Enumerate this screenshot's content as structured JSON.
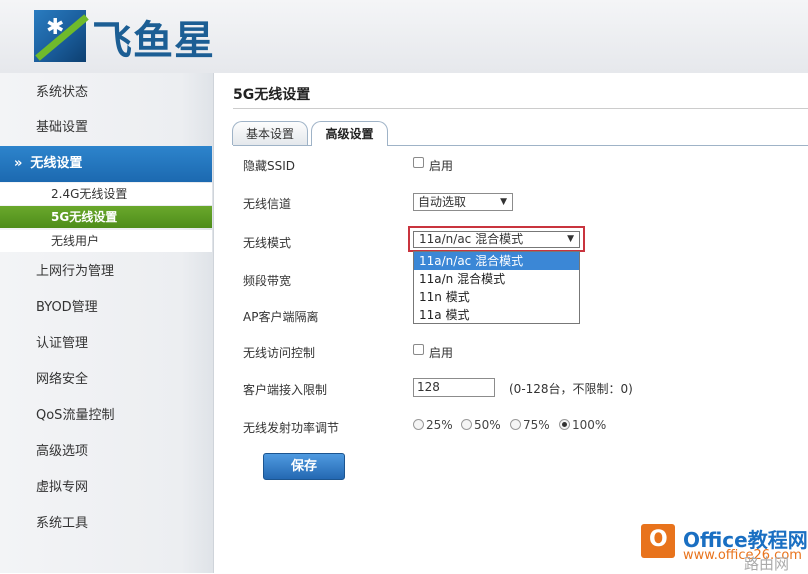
{
  "logo": {
    "text": "飞鱼星"
  },
  "sidebar": {
    "items": [
      {
        "label": "系统状态"
      },
      {
        "label": "基础设置"
      },
      {
        "label": "无线设置",
        "chevron": "»",
        "active": true
      },
      {
        "label": "上网行为管理"
      },
      {
        "label": "BYOD管理"
      },
      {
        "label": "认证管理"
      },
      {
        "label": "网络安全"
      },
      {
        "label": "QoS流量控制"
      },
      {
        "label": "高级选项"
      },
      {
        "label": "虚拟专网"
      },
      {
        "label": "系统工具"
      }
    ],
    "subitems": [
      {
        "label": "2.4G无线设置"
      },
      {
        "label": "5G无线设置",
        "active": true
      },
      {
        "label": "无线用户"
      }
    ]
  },
  "main": {
    "title": "5G无线设置",
    "tabs": [
      {
        "label": "基本设置"
      },
      {
        "label": "高级设置",
        "active": true
      }
    ],
    "fields": {
      "hide_ssid": {
        "label": "隐藏SSID",
        "checkbox_label": "启用",
        "checked": false
      },
      "channel": {
        "label": "无线信道",
        "value": "自动选取"
      },
      "mode": {
        "label": "无线模式",
        "value": "11a/n/ac 混合模式",
        "options": [
          "11a/n/ac 混合模式",
          "11a/n 混合模式",
          "11n 模式",
          "11a 模式"
        ]
      },
      "bandwidth": {
        "label": "频段带宽"
      },
      "ap_isolation": {
        "label": "AP客户端隔离"
      },
      "access_control": {
        "label": "无线访问控制",
        "checkbox_label": "启用",
        "checked": false
      },
      "client_limit": {
        "label": "客户端接入限制",
        "value": "128",
        "hint": "(0-128台，不限制：0)"
      },
      "tx_power": {
        "label": "无线发射功率调节",
        "options": [
          "25%",
          "50%",
          "75%",
          "100%"
        ],
        "selected": "100%"
      }
    },
    "save_label": "保存"
  },
  "watermark": {
    "icon_letter": "O",
    "title": "Office教程网",
    "url": "www.office26.com",
    "corner": "路由网"
  },
  "colors": {
    "accent_blue": "#1c69b0",
    "accent_green": "#4e8d1a",
    "highlight_red": "#c9343e"
  }
}
